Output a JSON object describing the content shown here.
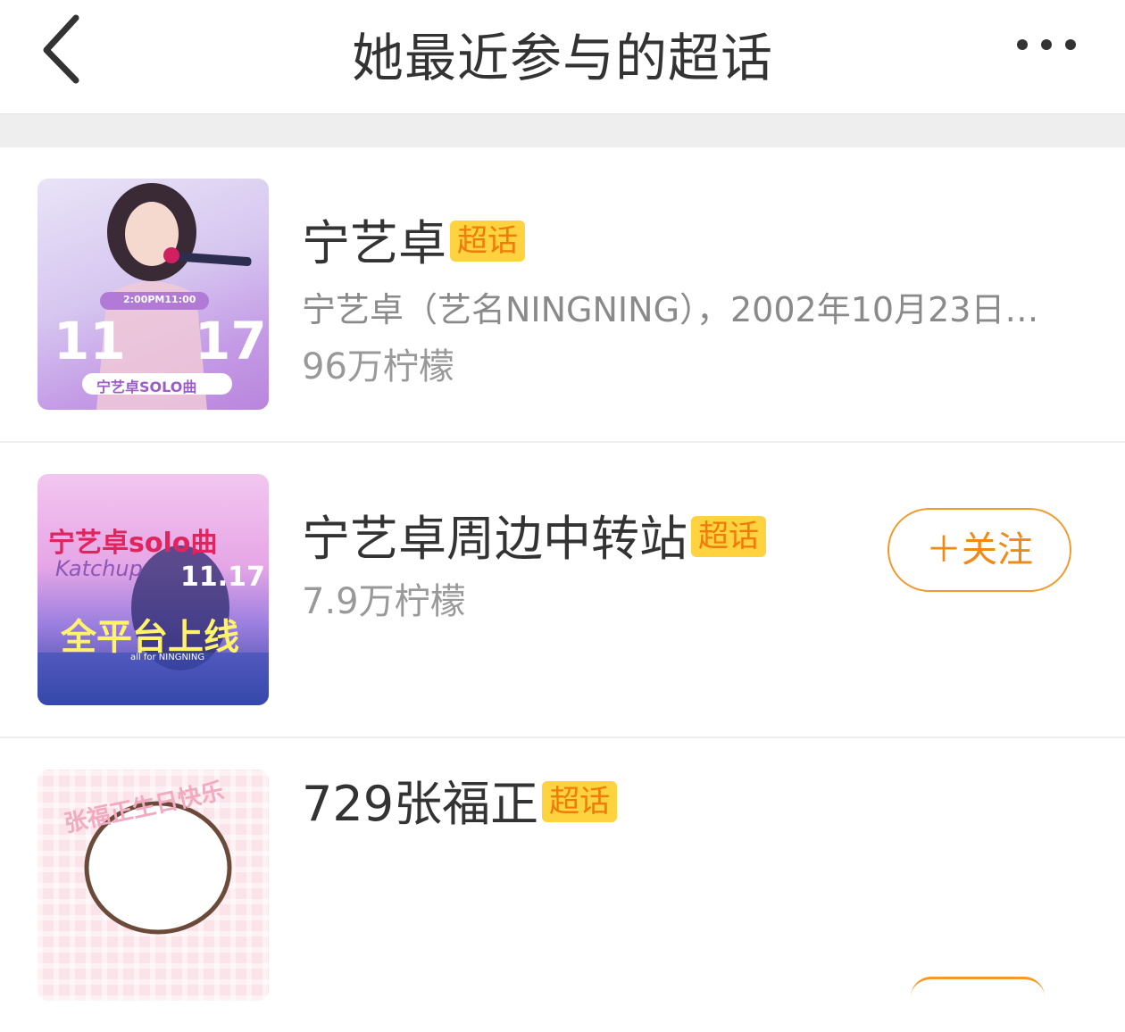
{
  "header": {
    "title": "她最近参与的超话",
    "back_icon": "chevron-left-icon",
    "more_icon": "more-dots-icon"
  },
  "list": [
    {
      "name": "宁艺卓",
      "badge": "超话",
      "description": "宁艺卓（艺名NINGNING），2002年10月23日…",
      "count": "96万柠檬",
      "thumb_text": {
        "time": "2:00PM11:00",
        "left_num": "11",
        "right_num": "17",
        "banner": "宁艺卓SOLO曲"
      }
    },
    {
      "name": "宁艺卓周边中转站",
      "badge": "超话",
      "count": "7.9万柠檬",
      "follow_label": "＋关注",
      "thumb_text": {
        "top": "宁艺卓solo曲",
        "date": "11.17",
        "main": "全平台上线",
        "script": "Katchup",
        "small": "all for NINGNING"
      }
    },
    {
      "name": "729张福正",
      "badge": "超话",
      "thumb_text": {
        "top": "张福正生日快乐"
      }
    }
  ],
  "colors": {
    "badge_bg": "#ffd23f",
    "badge_text": "#f07a0a",
    "follow_border": "#f29a2e",
    "follow_text": "#f08a14"
  }
}
